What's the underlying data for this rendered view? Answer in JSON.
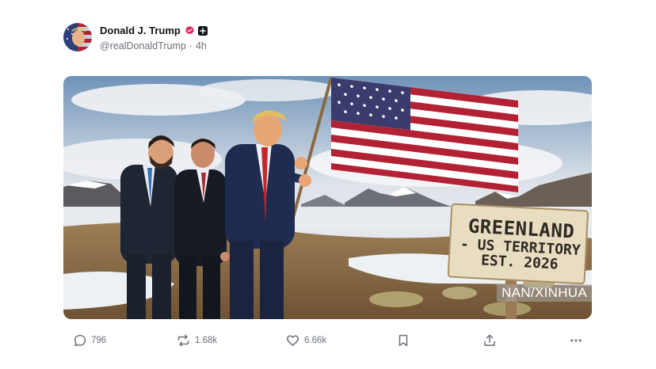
{
  "author": {
    "display_name": "Donald J. Trump",
    "handle": "@realDonaldTrump",
    "separator": "·",
    "time_ago": "4h"
  },
  "media": {
    "sign_lines": [
      "GREENLAND",
      "- US TERRITORY",
      "EST. 2026"
    ],
    "watermark": "NAN/XINHUA"
  },
  "actions": {
    "replies": "796",
    "reposts": "1.68k",
    "likes": "6.66k"
  },
  "colors": {
    "verified_badge": "#e0245e",
    "muted_text": "#6b7178",
    "flag_red": "#b22234",
    "flag_blue": "#3c3b6e"
  }
}
